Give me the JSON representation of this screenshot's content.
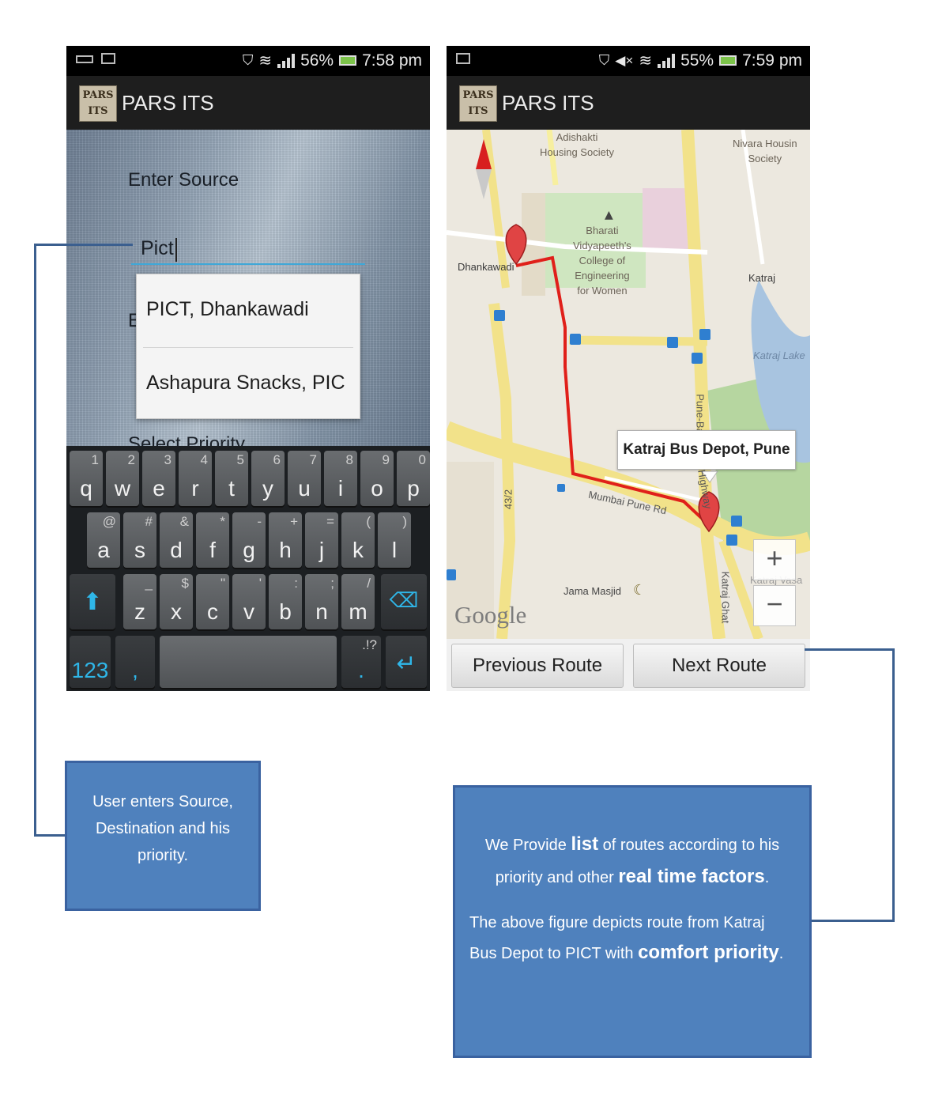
{
  "left_screen": {
    "status": {
      "battery_percent": "56%",
      "time": "7:58 pm"
    },
    "app_title": "PARS ITS",
    "logo_text": "PARS ITS",
    "source_label": "Enter Source",
    "source_value": "Pict",
    "dropdown_items": [
      "PICT, Dhankawadi",
      "Ashapura Snacks, PIC"
    ],
    "hidden_label_fragment": "E",
    "priority_label": "Select Priority",
    "keyboard": {
      "row1": [
        [
          "q",
          "1"
        ],
        [
          "w",
          "2"
        ],
        [
          "e",
          "3"
        ],
        [
          "r",
          "4"
        ],
        [
          "t",
          "5"
        ],
        [
          "y",
          "6"
        ],
        [
          "u",
          "7"
        ],
        [
          "i",
          "8"
        ],
        [
          "o",
          "9"
        ],
        [
          "p",
          "0"
        ]
      ],
      "row2": [
        [
          "a",
          "@"
        ],
        [
          "s",
          "#"
        ],
        [
          "d",
          "&"
        ],
        [
          "f",
          "*"
        ],
        [
          "g",
          "-"
        ],
        [
          "h",
          "+"
        ],
        [
          "j",
          "="
        ],
        [
          "k",
          "("
        ],
        [
          "l",
          ")"
        ]
      ],
      "row3": [
        [
          "z",
          "_"
        ],
        [
          "x",
          "$"
        ],
        [
          "c",
          "\""
        ],
        [
          "v",
          "'"
        ],
        [
          "b",
          ":"
        ],
        [
          "n",
          ";"
        ],
        [
          "m",
          "/"
        ]
      ],
      "numbers_key": "123",
      "comma_key": ",",
      "punct_key": ".!?",
      "period_key": "."
    }
  },
  "right_screen": {
    "status": {
      "battery_percent": "55%",
      "time": "7:59 pm"
    },
    "app_title": "PARS ITS",
    "logo_text": "PARS ITS",
    "map_labels": {
      "housing_society": "Adishakti\nHousing Society",
      "nivara": "Nivara Housin\nSociety",
      "college": "Bharati\nVidyapeeth's\nCollege of\nEngineering\nfor Women",
      "dhankawadi": "Dhankawadi",
      "katraj": "Katraj",
      "katraj_lake": "Katraj Lake",
      "pune_road": "Pune-Ba",
      "highway": "e Highway",
      "mumbai_pune": "Mumbai Pune Rd",
      "road_43": "43/2",
      "jama_masjid": "Jama Masjid",
      "katraj_ghat": "Katraj Ghat",
      "katraj_vasa": "Katraj Vasa",
      "google": "Google"
    },
    "callout": "Katraj Bus Depot, Pune",
    "zoom_in": "+",
    "zoom_out": "−",
    "prev_button": "Previous Route",
    "next_button": "Next Route"
  },
  "annotations": {
    "left_note": "User enters Source, Destination and his priority.",
    "right_note": {
      "p1_a": "We Provide ",
      "p1_b": "list",
      "p1_c": " of routes according to his priority and other ",
      "p1_d": "real time factors",
      "p1_e": ".",
      "p2_a": "The above figure depicts route from Katraj Bus Depot to PICT with ",
      "p2_b": "comfort priority",
      "p2_c": "."
    }
  },
  "colors": {
    "note_bg": "#4f81bd",
    "route": "#e0201a",
    "accent_blue": "#3fa8d8"
  }
}
